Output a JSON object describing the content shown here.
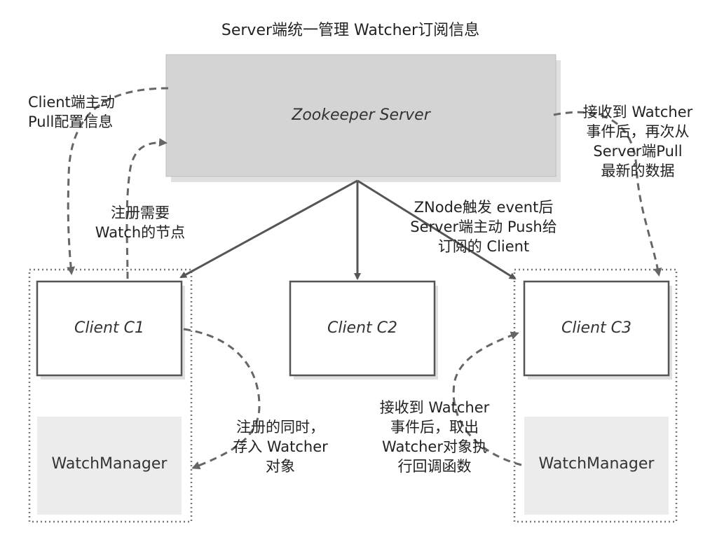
{
  "title": "Server端统一管理 Watcher订阅信息",
  "server": {
    "label": "Zookeeper Server"
  },
  "clients": [
    {
      "label": "Client C1"
    },
    {
      "label": "Client C2"
    },
    {
      "label": "Client C3"
    }
  ],
  "managers": [
    {
      "label": "WatchManager"
    },
    {
      "label": "WatchManager"
    }
  ],
  "annotations": {
    "pull_config": "Client端主动\nPull配置信息",
    "register_watch": "注册需要\nWatch的节点",
    "server_pull": "接收到 Watcher\n事件后，再次从\nServer端Pull\n最新的数据",
    "znode_push": "ZNode触发 event后\nServer端主动 Push给\n订阅的 Client",
    "store_watcher": "注册的同时，\n存入 Watcher\n对象",
    "callback": "接收到 Watcher\n事件后，取出\nWatcher对象执\n行回调函数"
  },
  "colors": {
    "server_fill": "#d4d4d4",
    "manager_fill": "#ececec",
    "line": "#555555",
    "dashed_line": "#666666"
  }
}
